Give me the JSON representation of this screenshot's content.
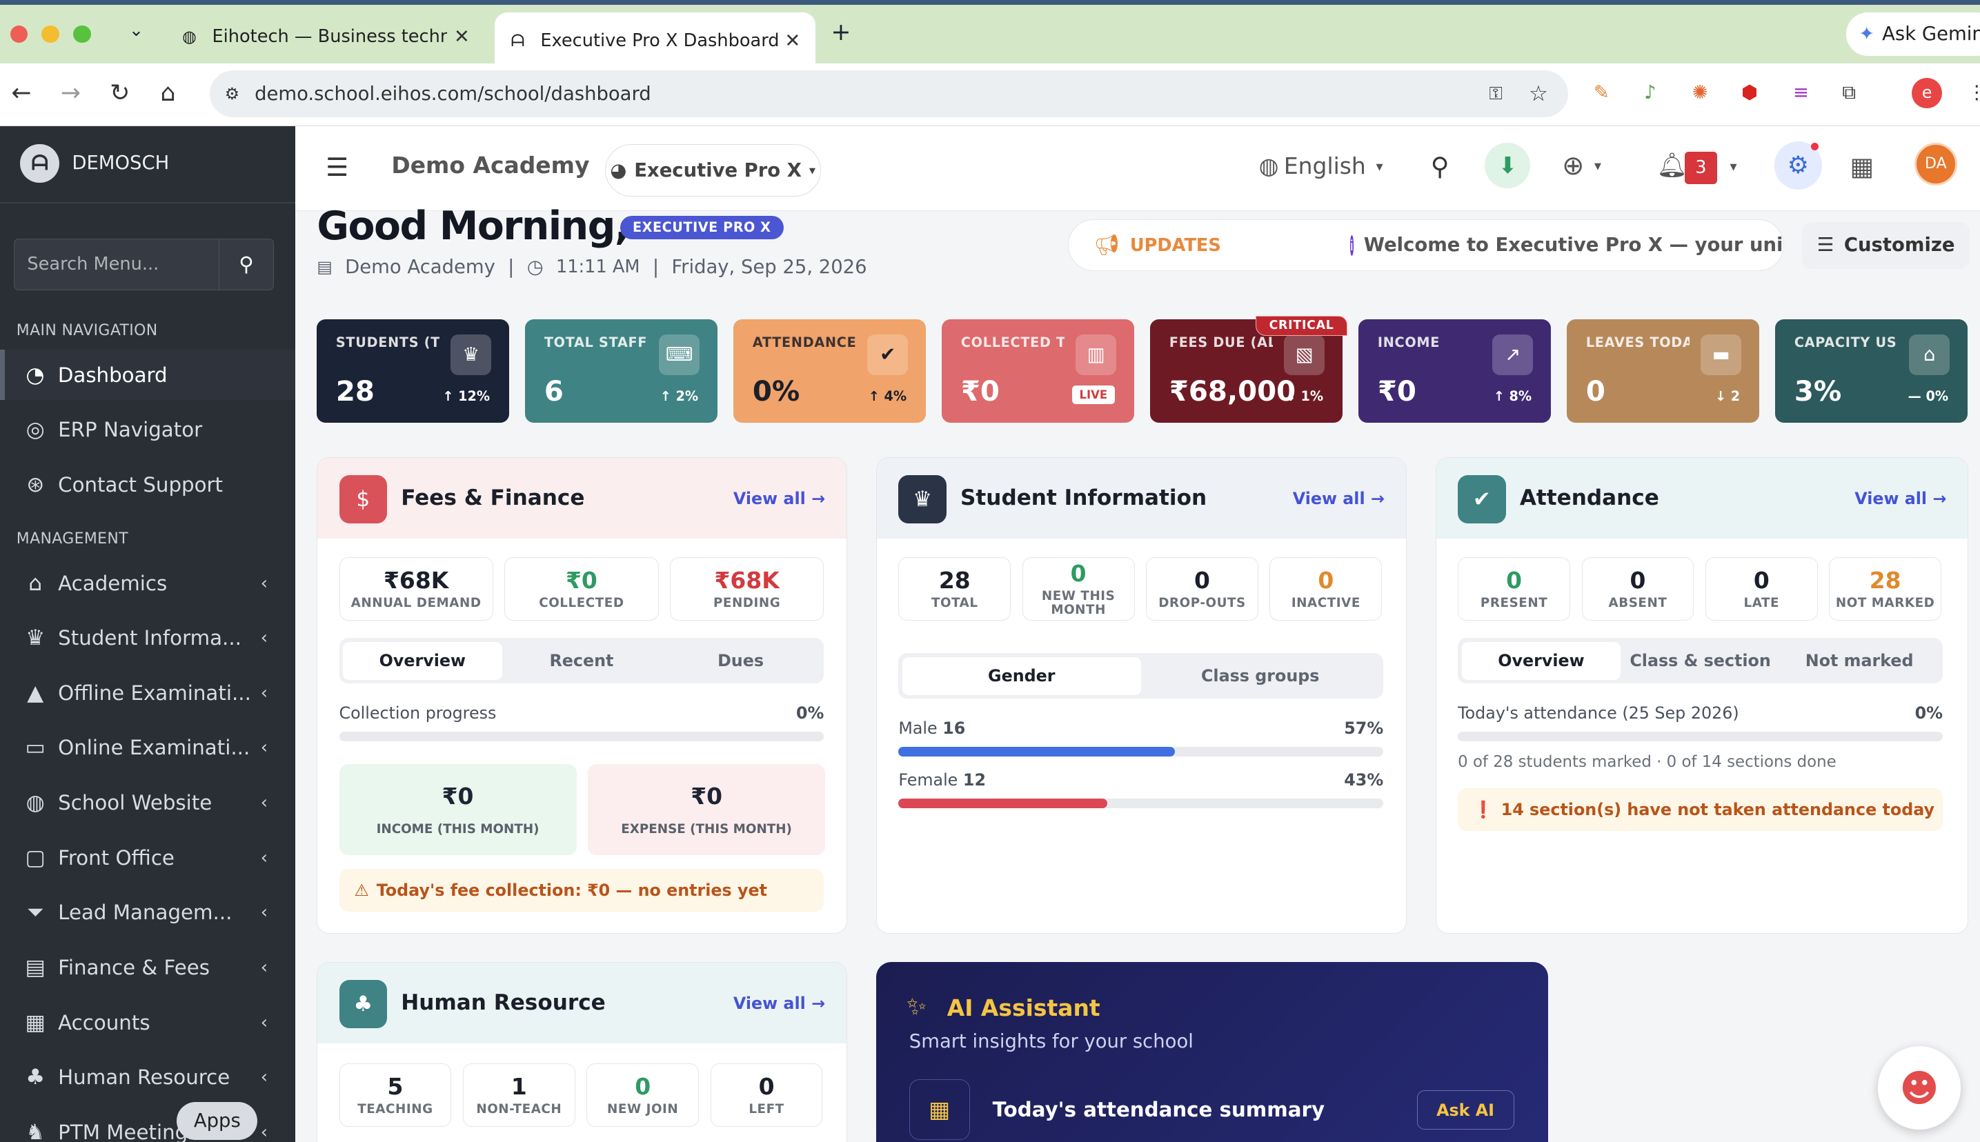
{
  "browser": {
    "tabs": [
      {
        "title": "Eihotech — Business technolo",
        "active": false
      },
      {
        "title": "Executive Pro X Dashboard",
        "active": true
      }
    ],
    "new_tab": "+",
    "url": "demo.school.eihos.com/school/dashboard",
    "ask_gemini": "Ask Gemin",
    "apps_tooltip": "Apps"
  },
  "sidebar": {
    "brand": "DEMOSCH",
    "search_placeholder": "Search Menu...",
    "main_heading": "MAIN NAVIGATION",
    "main_items": [
      {
        "label": "Dashboard",
        "icon": "dashboard-icon",
        "active": true
      },
      {
        "label": "ERP Navigator",
        "icon": "compass-icon"
      },
      {
        "label": "Contact Support",
        "icon": "lifebuoy-icon"
      }
    ],
    "mgmt_heading": "MANAGEMENT",
    "mgmt_items": [
      {
        "label": "Academics",
        "icon": "school-icon"
      },
      {
        "label": "Student Informa...",
        "icon": "graduate-icon"
      },
      {
        "label": "Offline Examinati...",
        "icon": "cap-icon"
      },
      {
        "label": "Online Examinati...",
        "icon": "laptop-icon"
      },
      {
        "label": "School Website",
        "icon": "globe-icon"
      },
      {
        "label": "Front Office",
        "icon": "monitor-icon"
      },
      {
        "label": "Lead Managem...",
        "icon": "funnel-icon"
      },
      {
        "label": "Finance & Fees",
        "icon": "wallet-icon"
      },
      {
        "label": "Accounts",
        "icon": "calculator-icon"
      },
      {
        "label": "Human Resource",
        "icon": "users-icon"
      },
      {
        "label": "PTM Meetings",
        "icon": "meeting-icon"
      }
    ]
  },
  "topbar": {
    "school": "Demo Academy",
    "theme": "Executive Pro X",
    "language": "English",
    "notif_count": "3",
    "avatar": "DA"
  },
  "header": {
    "greeting": "Good Morning,",
    "badge": "EXECUTIVE PRO X",
    "school": "Demo Academy",
    "time": "11:11 AM",
    "date": "Friday, Sep 25, 2026",
    "updates_label": "UPDATES",
    "updates_text": "Welcome to Executive Pro X — your unified",
    "customize": "Customize"
  },
  "stats": [
    {
      "label": "STUDENTS (T...",
      "value": "28",
      "change": "↑ 12%",
      "color": "#1b2336",
      "icon": "graduate-icon"
    },
    {
      "label": "TOTAL STAFF",
      "value": "6",
      "change": "↑ 2%",
      "color": "#3f8384",
      "icon": "teacher-icon"
    },
    {
      "label": "ATTENDANCE",
      "value": "0%",
      "change": "↑ 4%",
      "color": "#f0a36a",
      "icon": "clipboard-icon",
      "dark": true
    },
    {
      "label": "COLLECTED T...",
      "value": "₹0",
      "change": "LIVE",
      "color": "#dd6a6c",
      "icon": "register-icon"
    },
    {
      "label": "FEES DUE (ALL...",
      "value": "₹68,000",
      "change": "↓ 1%",
      "color": "#6e1a24",
      "icon": "document-icon",
      "flag": "CRITICAL"
    },
    {
      "label": "INCOME",
      "value": "₹0",
      "change": "↑ 8%",
      "color": "#3f2a72",
      "icon": "chart-icon"
    },
    {
      "label": "LEAVES TODAY",
      "value": "0",
      "change": "↓ 2",
      "color": "#b7895a",
      "icon": "bed-icon"
    },
    {
      "label": "CAPACITY US...",
      "value": "3%",
      "change": "— 0%",
      "color": "#2d5a5c",
      "icon": "building-icon"
    }
  ],
  "fees": {
    "title": "Fees & Finance",
    "view_all": "View all",
    "minis": [
      {
        "value": "₹68K",
        "label": "ANNUAL DEMAND",
        "color": "#1b1f29"
      },
      {
        "value": "₹0",
        "label": "COLLECTED",
        "color": "#2f9a63"
      },
      {
        "value": "₹68K",
        "label": "PENDING",
        "color": "#d23a3f"
      }
    ],
    "tabs": [
      "Overview",
      "Recent",
      "Dues"
    ],
    "progress_label": "Collection progress",
    "progress_value": "0%",
    "progress": 0,
    "income_value": "₹0",
    "income_label": "INCOME (THIS MONTH)",
    "expense_value": "₹0",
    "expense_label": "EXPENSE (THIS MONTH)",
    "alert": "Today's fee collection: ₹0 — no entries yet"
  },
  "students": {
    "title": "Student Information",
    "view_all": "View all",
    "minis": [
      {
        "value": "28",
        "label": "TOTAL",
        "color": "#1b1f29"
      },
      {
        "value": "0",
        "label": "NEW THIS\nMONTH",
        "color": "#2f9a63"
      },
      {
        "value": "0",
        "label": "DROP-OUTS",
        "color": "#1b1f29"
      },
      {
        "value": "0",
        "label": "INACTIVE",
        "color": "#e08a2c"
      }
    ],
    "tabs": [
      "Gender",
      "Class groups"
    ],
    "male_label": "Male",
    "male_count": "16",
    "male_pct": "57%",
    "male_share": 57,
    "female_label": "Female",
    "female_count": "12",
    "female_pct": "43%",
    "female_share": 43
  },
  "attendance": {
    "title": "Attendance",
    "view_all": "View all",
    "minis": [
      {
        "value": "0",
        "label": "PRESENT",
        "color": "#2f9a63"
      },
      {
        "value": "0",
        "label": "ABSENT",
        "color": "#1b1f29"
      },
      {
        "value": "0",
        "label": "LATE",
        "color": "#1b1f29"
      },
      {
        "value": "28",
        "label": "NOT MARKED",
        "color": "#e08a2c"
      }
    ],
    "tabs": [
      "Overview",
      "Class & section",
      "Not marked"
    ],
    "today_label": "Today's attendance (25 Sep 2026)",
    "today_value": "0%",
    "today_progress": 0,
    "summary": "0 of 28 students marked · 0 of 14 sections done",
    "alert": "14 section(s) have not taken attendance today"
  },
  "hr": {
    "title": "Human Resource",
    "view_all": "View all",
    "minis": [
      {
        "value": "5",
        "label": "TEACHING",
        "color": "#1b1f29"
      },
      {
        "value": "1",
        "label": "NON-TEACH",
        "color": "#1b1f29"
      },
      {
        "value": "0",
        "label": "NEW JOIN",
        "color": "#2f9a63"
      },
      {
        "value": "0",
        "label": "LEFT",
        "color": "#1b1f29"
      }
    ]
  },
  "ai": {
    "title": "AI Assistant",
    "subtitle": "Smart insights for your school",
    "item": "Today's attendance summary",
    "button": "Ask AI"
  }
}
